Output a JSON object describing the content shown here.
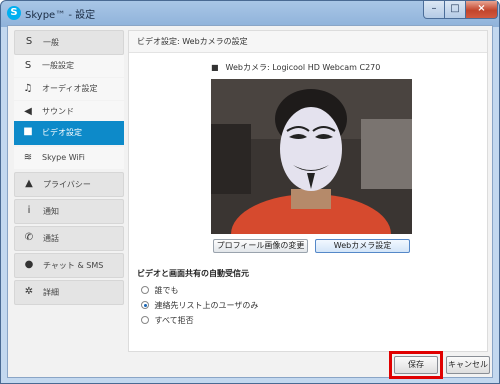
{
  "window": {
    "title": "Skype™ - 設定",
    "icon": "skype-icon"
  },
  "sidebar": {
    "items": [
      {
        "label": "一般",
        "icon": "skype-icon",
        "kind": "group"
      },
      {
        "label": "一般設定",
        "icon": "skype-icon",
        "kind": "sub"
      },
      {
        "label": "オーディオ設定",
        "icon": "headset-icon",
        "kind": "sub"
      },
      {
        "label": "サウンド",
        "icon": "speaker-icon",
        "kind": "sub"
      },
      {
        "label": "ビデオ設定",
        "icon": "video-camera-icon",
        "kind": "sub",
        "active": true
      },
      {
        "label": "Skype WiFi",
        "icon": "wifi-icon",
        "kind": "sub"
      },
      {
        "label": "プライバシー",
        "icon": "lock-icon",
        "kind": "group"
      },
      {
        "label": "通知",
        "icon": "info-icon",
        "kind": "group"
      },
      {
        "label": "通話",
        "icon": "phone-icon",
        "kind": "group"
      },
      {
        "label": "チャット & SMS",
        "icon": "chat-icon",
        "kind": "group"
      },
      {
        "label": "詳細",
        "icon": "gear-icon",
        "kind": "group"
      }
    ]
  },
  "panel": {
    "heading": "ビデオ設定: Webカメラの設定",
    "webcam_label": "Webカメラ:",
    "webcam_name": "Logicool HD Webcam C270",
    "profile_button": "プロフィール画像の変更",
    "webcam_settings_button": "Webカメラ設定",
    "auto_receive_title": "ビデオと画面共有の自動受信元",
    "options": [
      {
        "label": "誰でも",
        "selected": false
      },
      {
        "label": "連絡先リスト上のユーザのみ",
        "selected": true
      },
      {
        "label": "すべて拒否",
        "selected": false
      }
    ]
  },
  "footer": {
    "save": "保存",
    "cancel": "キャンセル"
  },
  "colors": {
    "accent": "#0d8ac9",
    "highlight": "#e00000"
  }
}
